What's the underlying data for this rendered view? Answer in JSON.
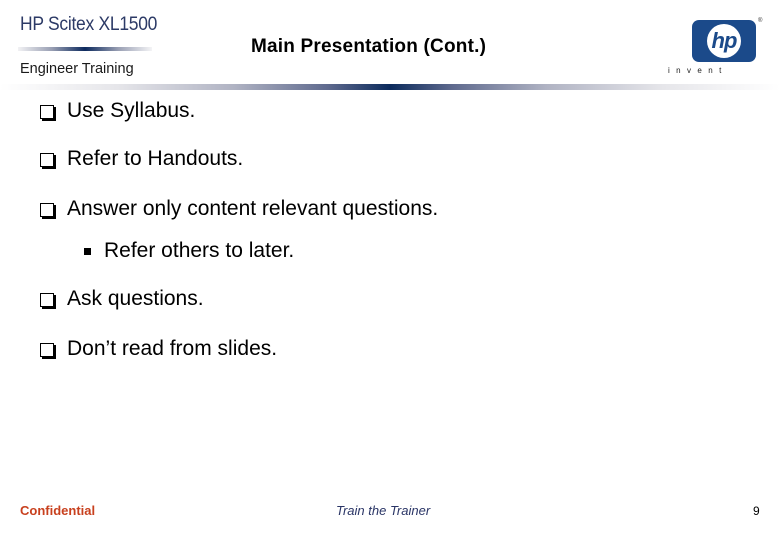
{
  "header": {
    "product_name": "HP Scitex XL1500",
    "subtitle": "Engineer  Training",
    "title": "Main Presentation (Cont.)",
    "logo": {
      "icon": "hp-logo-icon",
      "text": "hp",
      "tagline": "invent",
      "trademark": "®",
      "color": "#1b4a8a"
    }
  },
  "body": {
    "bullets": [
      {
        "level": 1,
        "icon": "checkbox-bullet-icon",
        "text": "Use Syllabus."
      },
      {
        "level": 1,
        "icon": "checkbox-bullet-icon",
        "text": "Refer to Handouts."
      },
      {
        "level": 1,
        "icon": "checkbox-bullet-icon",
        "text": "Answer only content relevant questions."
      },
      {
        "level": 2,
        "icon": "square-bullet-icon",
        "text": "Refer others to later."
      },
      {
        "level": 1,
        "icon": "checkbox-bullet-icon",
        "text": "Ask questions."
      },
      {
        "level": 1,
        "icon": "checkbox-bullet-icon",
        "text": "Don’t read from slides."
      }
    ]
  },
  "footer": {
    "left": "Confidential",
    "center": "Train the Trainer",
    "page_number": "9",
    "colors": {
      "left": "#c8401e",
      "center": "#2a3566"
    }
  }
}
